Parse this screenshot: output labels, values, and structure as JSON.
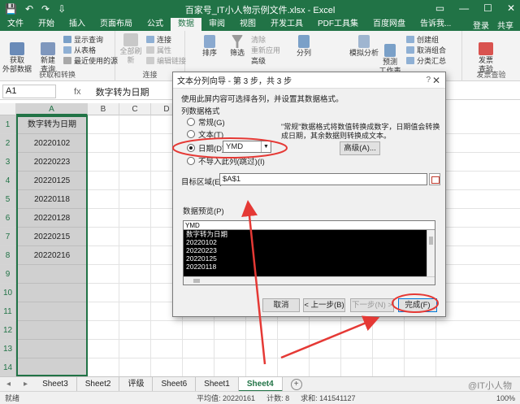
{
  "window": {
    "title": "百家号_IT小人物示例文件.xlsx - Excel",
    "quick_access": [
      "💾",
      "↶",
      "↷",
      "⇩"
    ],
    "controls": [
      "▭",
      "—",
      "☐",
      "✕"
    ]
  },
  "ribbon_tabs": [
    "文件",
    "开始",
    "插入",
    "页面布局",
    "公式",
    "数据",
    "审阅",
    "视图",
    "开发工具",
    "PDF工具集",
    "百度网盘",
    "告诉我..."
  ],
  "ribbon_right": [
    "登录",
    "共享"
  ],
  "ribbon": {
    "get_external": "获取\n外部数据",
    "new_query": "新建\n查询",
    "show_query": "显示查询",
    "from_table": "从表格",
    "recent_sources": "最近使用的源",
    "group1": "获取和转换",
    "refresh_all": "全部刷新",
    "connections": "连接",
    "properties": "属性",
    "edit_links": "编辑链接",
    "group2": "连接",
    "sort": "排序",
    "filter": "筛选",
    "clear": "清除",
    "reapply": "重新应用",
    "advanced": "高级",
    "split": "分列",
    "whatif": "模拟分析",
    "forecast": "预测\n工作表",
    "create_group": "创建组",
    "ungroup": "取消组合",
    "subtotal": "分类汇总",
    "invoice": "发票\n查验",
    "group_invoice": "发票查验"
  },
  "formula_bar": {
    "name_box": "A1",
    "fx": "fx",
    "formula": "数字转为日期"
  },
  "grid": {
    "columns": [
      "A",
      "B",
      "C",
      "D",
      "E",
      "F",
      "G",
      "H",
      "I",
      "J",
      "K",
      "L"
    ],
    "rows": [
      "1",
      "2",
      "3",
      "4",
      "5",
      "6",
      "7",
      "8",
      "9",
      "10",
      "11",
      "12",
      "13",
      "14"
    ],
    "column_a": [
      "数字转为日期",
      "20220102",
      "20220223",
      "20220125",
      "20220118",
      "20220128",
      "20220215",
      "20220216",
      "",
      "",
      "",
      "",
      "",
      ""
    ]
  },
  "sheets": {
    "nav": [
      "◂",
      "▸"
    ],
    "tabs": [
      "Sheet3",
      "Sheet2",
      "评级",
      "Sheet6",
      "Sheet1",
      "Sheet4"
    ],
    "active": "Sheet4",
    "add": "+"
  },
  "status": {
    "ready": "就绪",
    "average": "平均值: 20220161",
    "count": "计数: 8",
    "sum": "求和: 141541127",
    "zoom": "100%"
  },
  "dialog": {
    "title": "文本分列向导 - 第 3 步，共 3 步",
    "help": "?",
    "close": "✕",
    "instruction": "使用此屏内容可选择各列，并设置其数据格式。",
    "section_format": "列数据格式",
    "opt_general": "常规(G)",
    "opt_text": "文本(T)",
    "opt_date": "日期(D):",
    "date_value": "YMD",
    "opt_skip": "不导入此列(跳过)(I)",
    "note": "\"常规\"数据格式将数值转换成数字，日期值会转换成日期，其余数据则转换成文本。",
    "advanced_btn": "高级(A)...",
    "dest_label": "目标区域(E):",
    "dest_value": "$A$1",
    "preview_label": "数据预览(P)",
    "preview_header": "YMD",
    "preview_lines": [
      "数字转为日期",
      "20220102",
      "20220223",
      "20220125",
      "20220118"
    ],
    "btn_cancel": "取消",
    "btn_back": "< 上一步(B)",
    "btn_next": "下一步(N) >",
    "btn_finish": "完成(F)"
  },
  "watermark": "@IT小人物",
  "accent": "#217346",
  "annotation_color": "#e53935"
}
